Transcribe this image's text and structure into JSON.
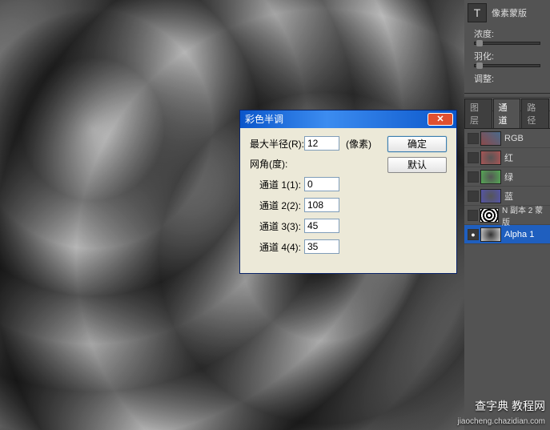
{
  "dialog": {
    "title": "彩色半调",
    "max_radius_label": "最大半径(R):",
    "max_radius_value": "12",
    "px_label": "(像素)",
    "grid_angle_label": "网角(度):",
    "ch1_label": "通道 1(1):",
    "ch1_value": "0",
    "ch2_label": "通道 2(2):",
    "ch2_value": "108",
    "ch3_label": "通道 3(3):",
    "ch3_value": "45",
    "ch4_label": "通道 4(4):",
    "ch4_value": "35",
    "ok_label": "确定",
    "default_label": "默认"
  },
  "side": {
    "mask_title": "像素蒙版",
    "density_label": "浓度:",
    "feather_label": "羽化:",
    "adjust_label": "调整:",
    "tabs": {
      "layers": "图层",
      "channels": "通道",
      "paths": "路径"
    },
    "channels": {
      "rgb": "RGB",
      "r": "红",
      "g": "绿",
      "b": "蓝",
      "mask": "N 副本 2 蒙版",
      "alpha": "Alpha 1"
    }
  },
  "watermark": {
    "main": "查字典 教程网",
    "sub": "jiaocheng.chazidian.com"
  }
}
